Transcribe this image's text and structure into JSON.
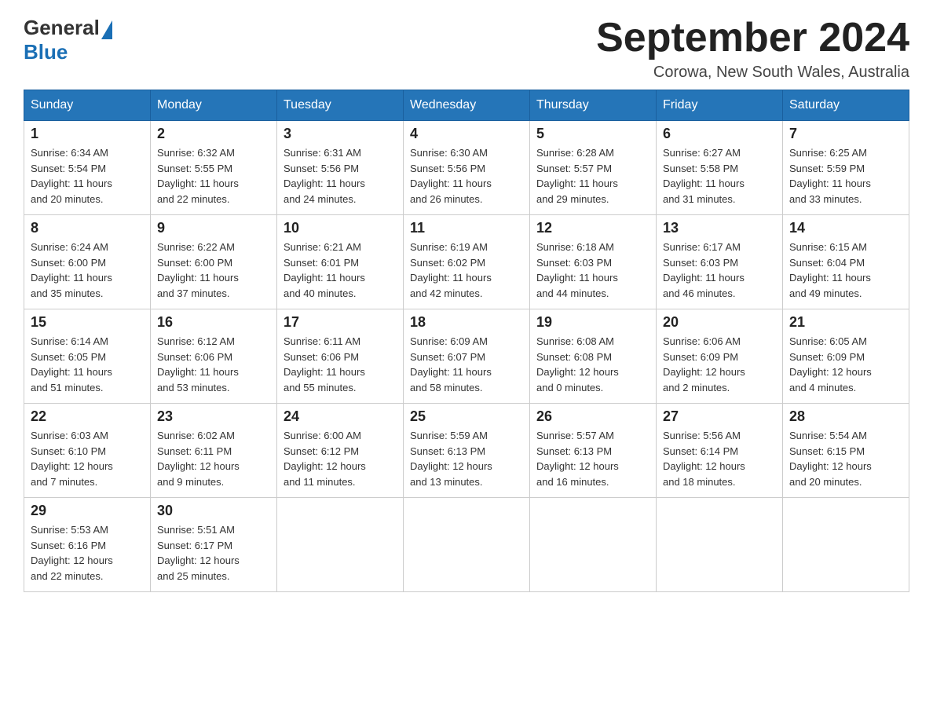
{
  "header": {
    "logo_general": "General",
    "logo_blue": "Blue",
    "month_title": "September 2024",
    "location": "Corowa, New South Wales, Australia"
  },
  "days_of_week": [
    "Sunday",
    "Monday",
    "Tuesday",
    "Wednesday",
    "Thursday",
    "Friday",
    "Saturday"
  ],
  "weeks": [
    [
      {
        "day": "1",
        "info": "Sunrise: 6:34 AM\nSunset: 5:54 PM\nDaylight: 11 hours\nand 20 minutes."
      },
      {
        "day": "2",
        "info": "Sunrise: 6:32 AM\nSunset: 5:55 PM\nDaylight: 11 hours\nand 22 minutes."
      },
      {
        "day": "3",
        "info": "Sunrise: 6:31 AM\nSunset: 5:56 PM\nDaylight: 11 hours\nand 24 minutes."
      },
      {
        "day": "4",
        "info": "Sunrise: 6:30 AM\nSunset: 5:56 PM\nDaylight: 11 hours\nand 26 minutes."
      },
      {
        "day": "5",
        "info": "Sunrise: 6:28 AM\nSunset: 5:57 PM\nDaylight: 11 hours\nand 29 minutes."
      },
      {
        "day": "6",
        "info": "Sunrise: 6:27 AM\nSunset: 5:58 PM\nDaylight: 11 hours\nand 31 minutes."
      },
      {
        "day": "7",
        "info": "Sunrise: 6:25 AM\nSunset: 5:59 PM\nDaylight: 11 hours\nand 33 minutes."
      }
    ],
    [
      {
        "day": "8",
        "info": "Sunrise: 6:24 AM\nSunset: 6:00 PM\nDaylight: 11 hours\nand 35 minutes."
      },
      {
        "day": "9",
        "info": "Sunrise: 6:22 AM\nSunset: 6:00 PM\nDaylight: 11 hours\nand 37 minutes."
      },
      {
        "day": "10",
        "info": "Sunrise: 6:21 AM\nSunset: 6:01 PM\nDaylight: 11 hours\nand 40 minutes."
      },
      {
        "day": "11",
        "info": "Sunrise: 6:19 AM\nSunset: 6:02 PM\nDaylight: 11 hours\nand 42 minutes."
      },
      {
        "day": "12",
        "info": "Sunrise: 6:18 AM\nSunset: 6:03 PM\nDaylight: 11 hours\nand 44 minutes."
      },
      {
        "day": "13",
        "info": "Sunrise: 6:17 AM\nSunset: 6:03 PM\nDaylight: 11 hours\nand 46 minutes."
      },
      {
        "day": "14",
        "info": "Sunrise: 6:15 AM\nSunset: 6:04 PM\nDaylight: 11 hours\nand 49 minutes."
      }
    ],
    [
      {
        "day": "15",
        "info": "Sunrise: 6:14 AM\nSunset: 6:05 PM\nDaylight: 11 hours\nand 51 minutes."
      },
      {
        "day": "16",
        "info": "Sunrise: 6:12 AM\nSunset: 6:06 PM\nDaylight: 11 hours\nand 53 minutes."
      },
      {
        "day": "17",
        "info": "Sunrise: 6:11 AM\nSunset: 6:06 PM\nDaylight: 11 hours\nand 55 minutes."
      },
      {
        "day": "18",
        "info": "Sunrise: 6:09 AM\nSunset: 6:07 PM\nDaylight: 11 hours\nand 58 minutes."
      },
      {
        "day": "19",
        "info": "Sunrise: 6:08 AM\nSunset: 6:08 PM\nDaylight: 12 hours\nand 0 minutes."
      },
      {
        "day": "20",
        "info": "Sunrise: 6:06 AM\nSunset: 6:09 PM\nDaylight: 12 hours\nand 2 minutes."
      },
      {
        "day": "21",
        "info": "Sunrise: 6:05 AM\nSunset: 6:09 PM\nDaylight: 12 hours\nand 4 minutes."
      }
    ],
    [
      {
        "day": "22",
        "info": "Sunrise: 6:03 AM\nSunset: 6:10 PM\nDaylight: 12 hours\nand 7 minutes."
      },
      {
        "day": "23",
        "info": "Sunrise: 6:02 AM\nSunset: 6:11 PM\nDaylight: 12 hours\nand 9 minutes."
      },
      {
        "day": "24",
        "info": "Sunrise: 6:00 AM\nSunset: 6:12 PM\nDaylight: 12 hours\nand 11 minutes."
      },
      {
        "day": "25",
        "info": "Sunrise: 5:59 AM\nSunset: 6:13 PM\nDaylight: 12 hours\nand 13 minutes."
      },
      {
        "day": "26",
        "info": "Sunrise: 5:57 AM\nSunset: 6:13 PM\nDaylight: 12 hours\nand 16 minutes."
      },
      {
        "day": "27",
        "info": "Sunrise: 5:56 AM\nSunset: 6:14 PM\nDaylight: 12 hours\nand 18 minutes."
      },
      {
        "day": "28",
        "info": "Sunrise: 5:54 AM\nSunset: 6:15 PM\nDaylight: 12 hours\nand 20 minutes."
      }
    ],
    [
      {
        "day": "29",
        "info": "Sunrise: 5:53 AM\nSunset: 6:16 PM\nDaylight: 12 hours\nand 22 minutes."
      },
      {
        "day": "30",
        "info": "Sunrise: 5:51 AM\nSunset: 6:17 PM\nDaylight: 12 hours\nand 25 minutes."
      },
      {
        "day": "",
        "info": ""
      },
      {
        "day": "",
        "info": ""
      },
      {
        "day": "",
        "info": ""
      },
      {
        "day": "",
        "info": ""
      },
      {
        "day": "",
        "info": ""
      }
    ]
  ]
}
